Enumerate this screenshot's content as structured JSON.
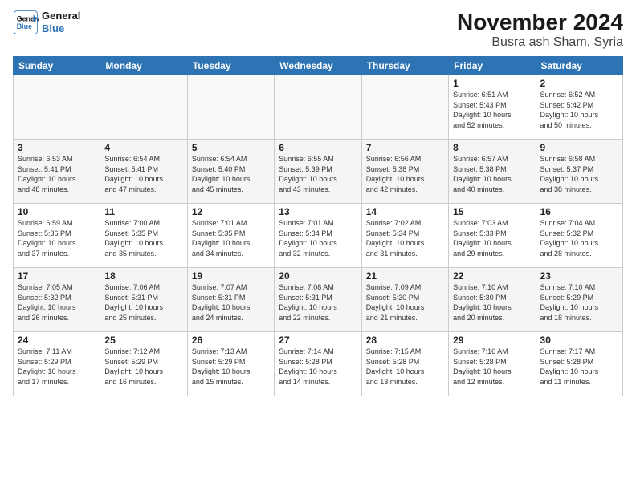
{
  "logo": {
    "line1": "General",
    "line2": "Blue"
  },
  "title": "November 2024",
  "subtitle": "Busra ash Sham, Syria",
  "weekdays": [
    "Sunday",
    "Monday",
    "Tuesday",
    "Wednesday",
    "Thursday",
    "Friday",
    "Saturday"
  ],
  "rows": [
    [
      {
        "day": "",
        "info": ""
      },
      {
        "day": "",
        "info": ""
      },
      {
        "day": "",
        "info": ""
      },
      {
        "day": "",
        "info": ""
      },
      {
        "day": "",
        "info": ""
      },
      {
        "day": "1",
        "info": "Sunrise: 6:51 AM\nSunset: 5:43 PM\nDaylight: 10 hours\nand 52 minutes."
      },
      {
        "day": "2",
        "info": "Sunrise: 6:52 AM\nSunset: 5:42 PM\nDaylight: 10 hours\nand 50 minutes."
      }
    ],
    [
      {
        "day": "3",
        "info": "Sunrise: 6:53 AM\nSunset: 5:41 PM\nDaylight: 10 hours\nand 48 minutes."
      },
      {
        "day": "4",
        "info": "Sunrise: 6:54 AM\nSunset: 5:41 PM\nDaylight: 10 hours\nand 47 minutes."
      },
      {
        "day": "5",
        "info": "Sunrise: 6:54 AM\nSunset: 5:40 PM\nDaylight: 10 hours\nand 45 minutes."
      },
      {
        "day": "6",
        "info": "Sunrise: 6:55 AM\nSunset: 5:39 PM\nDaylight: 10 hours\nand 43 minutes."
      },
      {
        "day": "7",
        "info": "Sunrise: 6:56 AM\nSunset: 5:38 PM\nDaylight: 10 hours\nand 42 minutes."
      },
      {
        "day": "8",
        "info": "Sunrise: 6:57 AM\nSunset: 5:38 PM\nDaylight: 10 hours\nand 40 minutes."
      },
      {
        "day": "9",
        "info": "Sunrise: 6:58 AM\nSunset: 5:37 PM\nDaylight: 10 hours\nand 38 minutes."
      }
    ],
    [
      {
        "day": "10",
        "info": "Sunrise: 6:59 AM\nSunset: 5:36 PM\nDaylight: 10 hours\nand 37 minutes."
      },
      {
        "day": "11",
        "info": "Sunrise: 7:00 AM\nSunset: 5:35 PM\nDaylight: 10 hours\nand 35 minutes."
      },
      {
        "day": "12",
        "info": "Sunrise: 7:01 AM\nSunset: 5:35 PM\nDaylight: 10 hours\nand 34 minutes."
      },
      {
        "day": "13",
        "info": "Sunrise: 7:01 AM\nSunset: 5:34 PM\nDaylight: 10 hours\nand 32 minutes."
      },
      {
        "day": "14",
        "info": "Sunrise: 7:02 AM\nSunset: 5:34 PM\nDaylight: 10 hours\nand 31 minutes."
      },
      {
        "day": "15",
        "info": "Sunrise: 7:03 AM\nSunset: 5:33 PM\nDaylight: 10 hours\nand 29 minutes."
      },
      {
        "day": "16",
        "info": "Sunrise: 7:04 AM\nSunset: 5:32 PM\nDaylight: 10 hours\nand 28 minutes."
      }
    ],
    [
      {
        "day": "17",
        "info": "Sunrise: 7:05 AM\nSunset: 5:32 PM\nDaylight: 10 hours\nand 26 minutes."
      },
      {
        "day": "18",
        "info": "Sunrise: 7:06 AM\nSunset: 5:31 PM\nDaylight: 10 hours\nand 25 minutes."
      },
      {
        "day": "19",
        "info": "Sunrise: 7:07 AM\nSunset: 5:31 PM\nDaylight: 10 hours\nand 24 minutes."
      },
      {
        "day": "20",
        "info": "Sunrise: 7:08 AM\nSunset: 5:31 PM\nDaylight: 10 hours\nand 22 minutes."
      },
      {
        "day": "21",
        "info": "Sunrise: 7:09 AM\nSunset: 5:30 PM\nDaylight: 10 hours\nand 21 minutes."
      },
      {
        "day": "22",
        "info": "Sunrise: 7:10 AM\nSunset: 5:30 PM\nDaylight: 10 hours\nand 20 minutes."
      },
      {
        "day": "23",
        "info": "Sunrise: 7:10 AM\nSunset: 5:29 PM\nDaylight: 10 hours\nand 18 minutes."
      }
    ],
    [
      {
        "day": "24",
        "info": "Sunrise: 7:11 AM\nSunset: 5:29 PM\nDaylight: 10 hours\nand 17 minutes."
      },
      {
        "day": "25",
        "info": "Sunrise: 7:12 AM\nSunset: 5:29 PM\nDaylight: 10 hours\nand 16 minutes."
      },
      {
        "day": "26",
        "info": "Sunrise: 7:13 AM\nSunset: 5:29 PM\nDaylight: 10 hours\nand 15 minutes."
      },
      {
        "day": "27",
        "info": "Sunrise: 7:14 AM\nSunset: 5:28 PM\nDaylight: 10 hours\nand 14 minutes."
      },
      {
        "day": "28",
        "info": "Sunrise: 7:15 AM\nSunset: 5:28 PM\nDaylight: 10 hours\nand 13 minutes."
      },
      {
        "day": "29",
        "info": "Sunrise: 7:16 AM\nSunset: 5:28 PM\nDaylight: 10 hours\nand 12 minutes."
      },
      {
        "day": "30",
        "info": "Sunrise: 7:17 AM\nSunset: 5:28 PM\nDaylight: 10 hours\nand 11 minutes."
      }
    ]
  ]
}
